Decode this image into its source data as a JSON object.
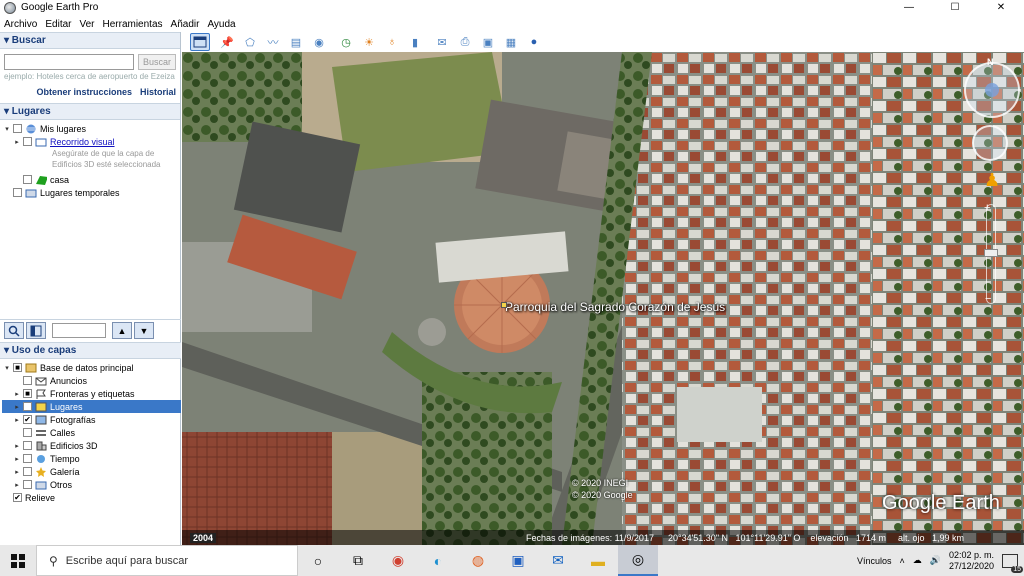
{
  "window": {
    "title": "Google Earth Pro",
    "minimize": "—",
    "maximize": "☐",
    "close": "✕"
  },
  "menu": [
    "Archivo",
    "Editar",
    "Ver",
    "Herramientas",
    "Añadir",
    "Ayuda"
  ],
  "search": {
    "header": "▾ Buscar",
    "placeholder": "",
    "button": "Buscar",
    "hint": "ejemplo: Hoteles cerca de aeropuerto de Ezeiza",
    "directions": "Obtener instrucciones",
    "history": "Historial"
  },
  "places": {
    "header": "▾ Lugares",
    "items": {
      "my_places": "Mis lugares",
      "tour": "Recorrido visual",
      "tour_desc1": "Asegúrate de que la capa de",
      "tour_desc2": "Edificios 3D esté seleccionada",
      "home": "casa",
      "temp": "Lugares temporales"
    }
  },
  "layers": {
    "header": "▾ Uso de capas",
    "items": [
      "Base de datos principal",
      "Anuncios",
      "Fronteras y etiquetas",
      "Lugares",
      "Fotografías",
      "Calles",
      "Edificios 3D",
      "Tiempo",
      "Galería",
      "Otros",
      "Relieve"
    ]
  },
  "map": {
    "label": "Parroquia del Sagrado Corazón de Jesús",
    "copyright1": "© 2020 INEGI",
    "copyright2": "© 2020 Google",
    "logo": "Google Earth",
    "year": "2004",
    "status": {
      "date": "Fechas de imágenes: 11/9/2017",
      "coords": "20°34'51.30\" N   101°11'29.91\" O",
      "elevation": "elevación   1714 m",
      "eye": "alt. ojo   1,99 km"
    }
  },
  "taskbar": {
    "search": "Escribe aquí para buscar",
    "links": "Vínculos",
    "time": "02:02 p. m.",
    "date": "27/12/2020",
    "notifications": "15"
  },
  "colors": {
    "accent": "#3a78c8",
    "header": "#1a3d7a"
  }
}
